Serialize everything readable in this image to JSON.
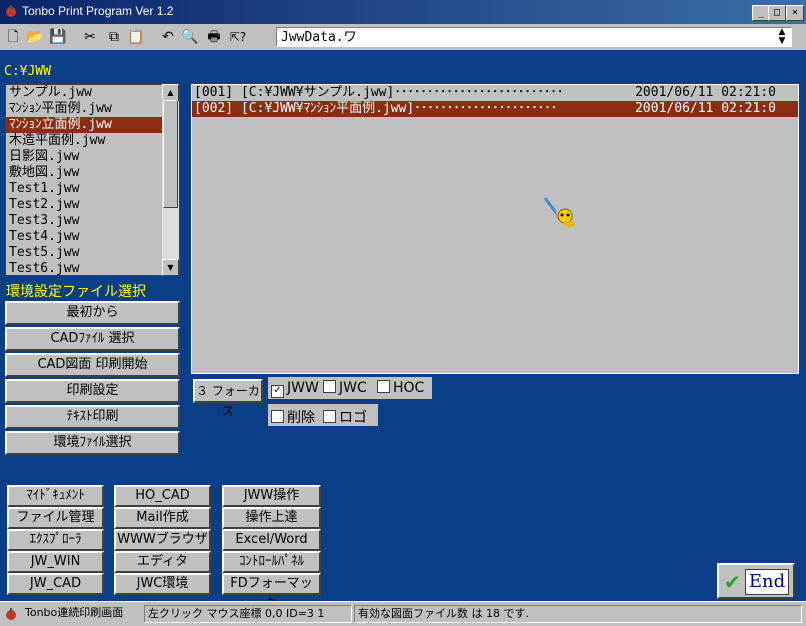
{
  "window": {
    "title": "Tonbo Print Program Ver 1.2",
    "minimize": "_",
    "maximize": "□",
    "close": "×"
  },
  "toolbar": {
    "icons": [
      "new-icon",
      "open-icon",
      "save-icon",
      "cut-icon",
      "copy-icon",
      "paste-icon",
      "undo-icon",
      "zoom-icon",
      "print-icon",
      "help-icon"
    ],
    "glyphs": {
      "new": "🗋",
      "open": "📂",
      "save": "💾",
      "cut": "✂",
      "copy": "⧉",
      "paste": "📋",
      "undo": "↶",
      "zoom": "🔍",
      "print": "🖶",
      "help": "⇱?"
    },
    "file_value": "JwwData.ワ",
    "spin_up": "▲",
    "spin_down": "▼"
  },
  "sidebar": {
    "path": "C:¥JWW",
    "files": [
      "サンプル.jww",
      "ﾏﾝｼｮﾝ平面例.jww",
      "ﾏﾝｼｮﾝ立面例.jww",
      "木造平面例.jww",
      "日影図.jww",
      "敷地図.jww",
      "Test1.jww",
      "Test2.jww",
      "Test3.jww",
      "Test4.jww",
      "Test5.jww",
      "Test6.jww"
    ],
    "selected_index": 2,
    "scroll_up": "▲",
    "scroll_down": "▼",
    "env_label": "環境設定ファイル選択",
    "buttons": [
      "最初から",
      "CADﾌｧｲﾙ 選択",
      "CAD図面 印刷開始",
      "印刷設定",
      "ﾃｷｽﾄ印刷",
      "環境ﾌｧｲﾙ選択"
    ]
  },
  "print_list": {
    "rows": [
      {
        "left": "[001] [C:¥JWW¥サンプル.jww]･･････････････････････････",
        "right": "2001/06/11 02:21:0",
        "selected": false
      },
      {
        "left": "[002] [C:¥JWW¥ﾏﾝｼｮﾝ平面例.jww]･･････････････････････",
        "right": "2001/06/11 02:21:0",
        "selected": true
      }
    ]
  },
  "options": {
    "focus_button": "３ フォーカス",
    "check_mark": "✓",
    "checks_row1": [
      {
        "label": "JWW",
        "checked": true
      },
      {
        "label": "JWC",
        "checked": false
      },
      {
        "label": "HOC",
        "checked": false
      }
    ],
    "checks_row2": [
      {
        "label": "削除",
        "checked": false
      },
      {
        "label": "ロゴ",
        "checked": false
      }
    ]
  },
  "launch_grid": {
    "col1": [
      "ﾏｲﾄﾞｷｭﾒﾝﾄ",
      "ファイル管理",
      "ｴｸｽﾌﾟﾛｰﾗ",
      "JW_WIN",
      "JW_CAD"
    ],
    "col2": [
      "HO_CAD",
      "Mail作成",
      "WWWブラウザ",
      "エディタ",
      "JWC環境"
    ],
    "col3": [
      "JWW操作",
      "操作上達",
      "Excel/Word",
      "ｺﾝﾄﾛｰﾙﾊﾟﾈﾙ",
      "FDフォーマット"
    ]
  },
  "end_button": {
    "label": "End",
    "check": "✔"
  },
  "statusbar": {
    "p1": "Tonbo連続印刷画面",
    "p2": "左クリック マウス座標 0,0 ID=3 1",
    "p3": "有効な図面ファイル数 は 18 です."
  },
  "colors": {
    "background": "#0a3e86",
    "selection": "#8b2d14",
    "label_yellow": "#ffff00"
  }
}
